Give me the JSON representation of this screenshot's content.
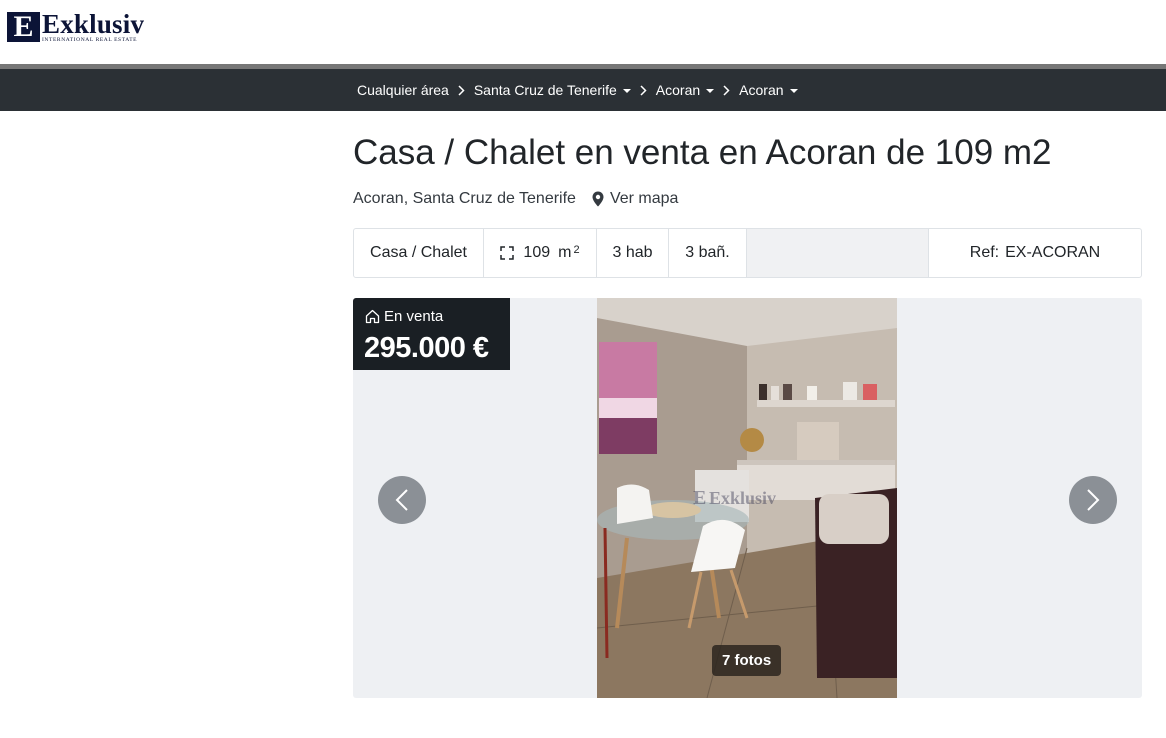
{
  "header": {
    "logo_letter": "E",
    "logo_name": "Exklusiv",
    "logo_tagline": "INTERNATIONAL REAL ESTATE"
  },
  "breadcrumbs": [
    {
      "label": "Cualquier área",
      "dropdown": false
    },
    {
      "label": "Santa Cruz de Tenerife",
      "dropdown": true
    },
    {
      "label": "Acoran",
      "dropdown": true
    },
    {
      "label": "Acoran",
      "dropdown": true
    }
  ],
  "listing": {
    "title": "Casa / Chalet en venta en Acoran de 109 m2",
    "location": "Acoran, Santa Cruz de Tenerife",
    "map_link": "Ver mapa"
  },
  "specs": {
    "type": "Casa / Chalet",
    "area_value": "109",
    "area_unit": "m",
    "area_exp": "2",
    "rooms": "3 hab",
    "baths": "3 bañ.",
    "ref_label": "Ref:",
    "ref_value": "EX-ACORAN"
  },
  "gallery": {
    "status": "En venta",
    "price": "295.000 €",
    "photo_count": "7 fotos",
    "watermark": "Exklusiv"
  },
  "colors": {
    "navbar": "#2b3035",
    "logo": "#0c1437",
    "price_box": "#1a1f24",
    "arrow": "#8b9096"
  },
  "icons": {
    "breadcrumb_separator": "chevron-right-icon",
    "map": "map-pin-icon",
    "area": "expand-icon",
    "status": "home-icon",
    "prev": "chevron-left-icon",
    "next": "chevron-right-icon"
  }
}
